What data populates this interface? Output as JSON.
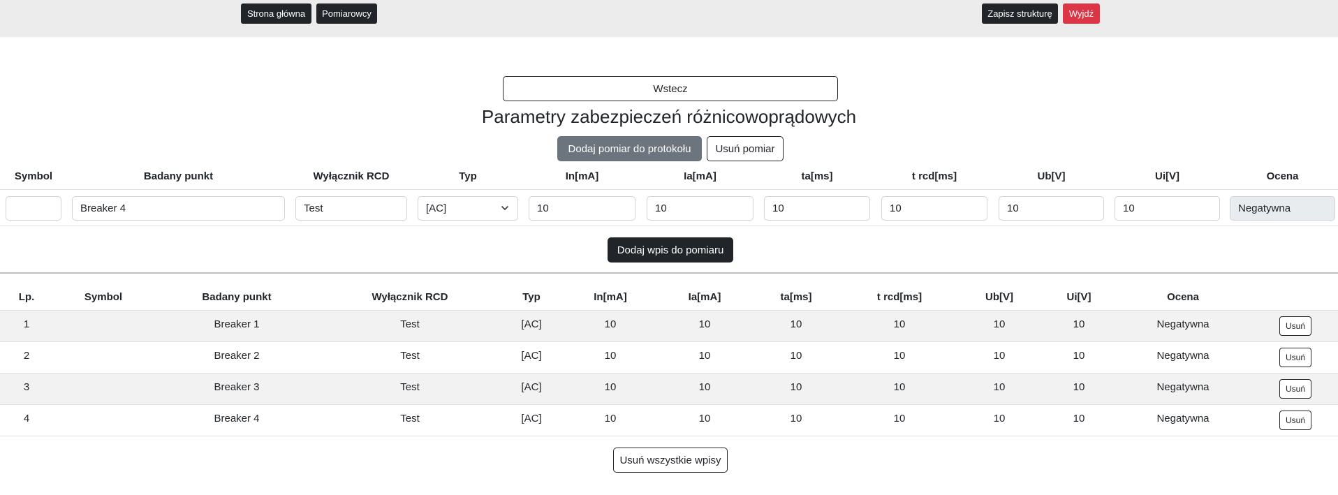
{
  "nav": {
    "home_label": "Strona główna",
    "measurers_label": "Pomiarowcy",
    "save_label": "Zapisz strukturę",
    "logout_label": "Wyjdź"
  },
  "back_label": "Wstecz",
  "title": "Parametry zabezpieczeń różnicowoprądowych",
  "actions": {
    "add_measurement_label": "Dodaj pomiar do protokołu",
    "remove_measurement_label": "Usuń pomiar",
    "add_entry_label": "Dodaj wpis do pomiaru",
    "remove_all_label": "Usuń wszystkie wpisy"
  },
  "form": {
    "headers": {
      "symbol": "Symbol",
      "point": "Badany punkt",
      "rcd": "Wyłącznik RCD",
      "type": "Typ",
      "in": "In[mA]",
      "ia": "Ia[mA]",
      "ta": "ta[ms]",
      "trcd": "t rcd[ms]",
      "ub": "Ub[V]",
      "ui": "Ui[V]",
      "rating": "Ocena"
    },
    "values": {
      "symbol": "",
      "point": "Breaker 4",
      "rcd": "Test",
      "type": "[AC]",
      "in": "10",
      "ia": "10",
      "ta": "10",
      "trcd": "10",
      "ub": "10",
      "ui": "10",
      "rating": "Negatywna"
    }
  },
  "table": {
    "headers": {
      "lp": "Lp.",
      "symbol": "Symbol",
      "point": "Badany punkt",
      "rcd": "Wyłącznik RCD",
      "type": "Typ",
      "in": "In[mA]",
      "ia": "Ia[mA]",
      "ta": "ta[ms]",
      "trcd": "t rcd[ms]",
      "ub": "Ub[V]",
      "ui": "Ui[V]",
      "rating": "Ocena"
    },
    "delete_label": "Usuń",
    "rows": [
      {
        "lp": "1",
        "symbol": "",
        "point": "Breaker 1",
        "rcd": "Test",
        "type": "[AC]",
        "in": "10",
        "ia": "10",
        "ta": "10",
        "trcd": "10",
        "ub": "10",
        "ui": "10",
        "rating": "Negatywna"
      },
      {
        "lp": "2",
        "symbol": "",
        "point": "Breaker 2",
        "rcd": "Test",
        "type": "[AC]",
        "in": "10",
        "ia": "10",
        "ta": "10",
        "trcd": "10",
        "ub": "10",
        "ui": "10",
        "rating": "Negatywna"
      },
      {
        "lp": "3",
        "symbol": "",
        "point": "Breaker 3",
        "rcd": "Test",
        "type": "[AC]",
        "in": "10",
        "ia": "10",
        "ta": "10",
        "trcd": "10",
        "ub": "10",
        "ui": "10",
        "rating": "Negatywna"
      },
      {
        "lp": "4",
        "symbol": "",
        "point": "Breaker 4",
        "rcd": "Test",
        "type": "[AC]",
        "in": "10",
        "ia": "10",
        "ta": "10",
        "trcd": "10",
        "ub": "10",
        "ui": "10",
        "rating": "Negatywna"
      }
    ]
  }
}
